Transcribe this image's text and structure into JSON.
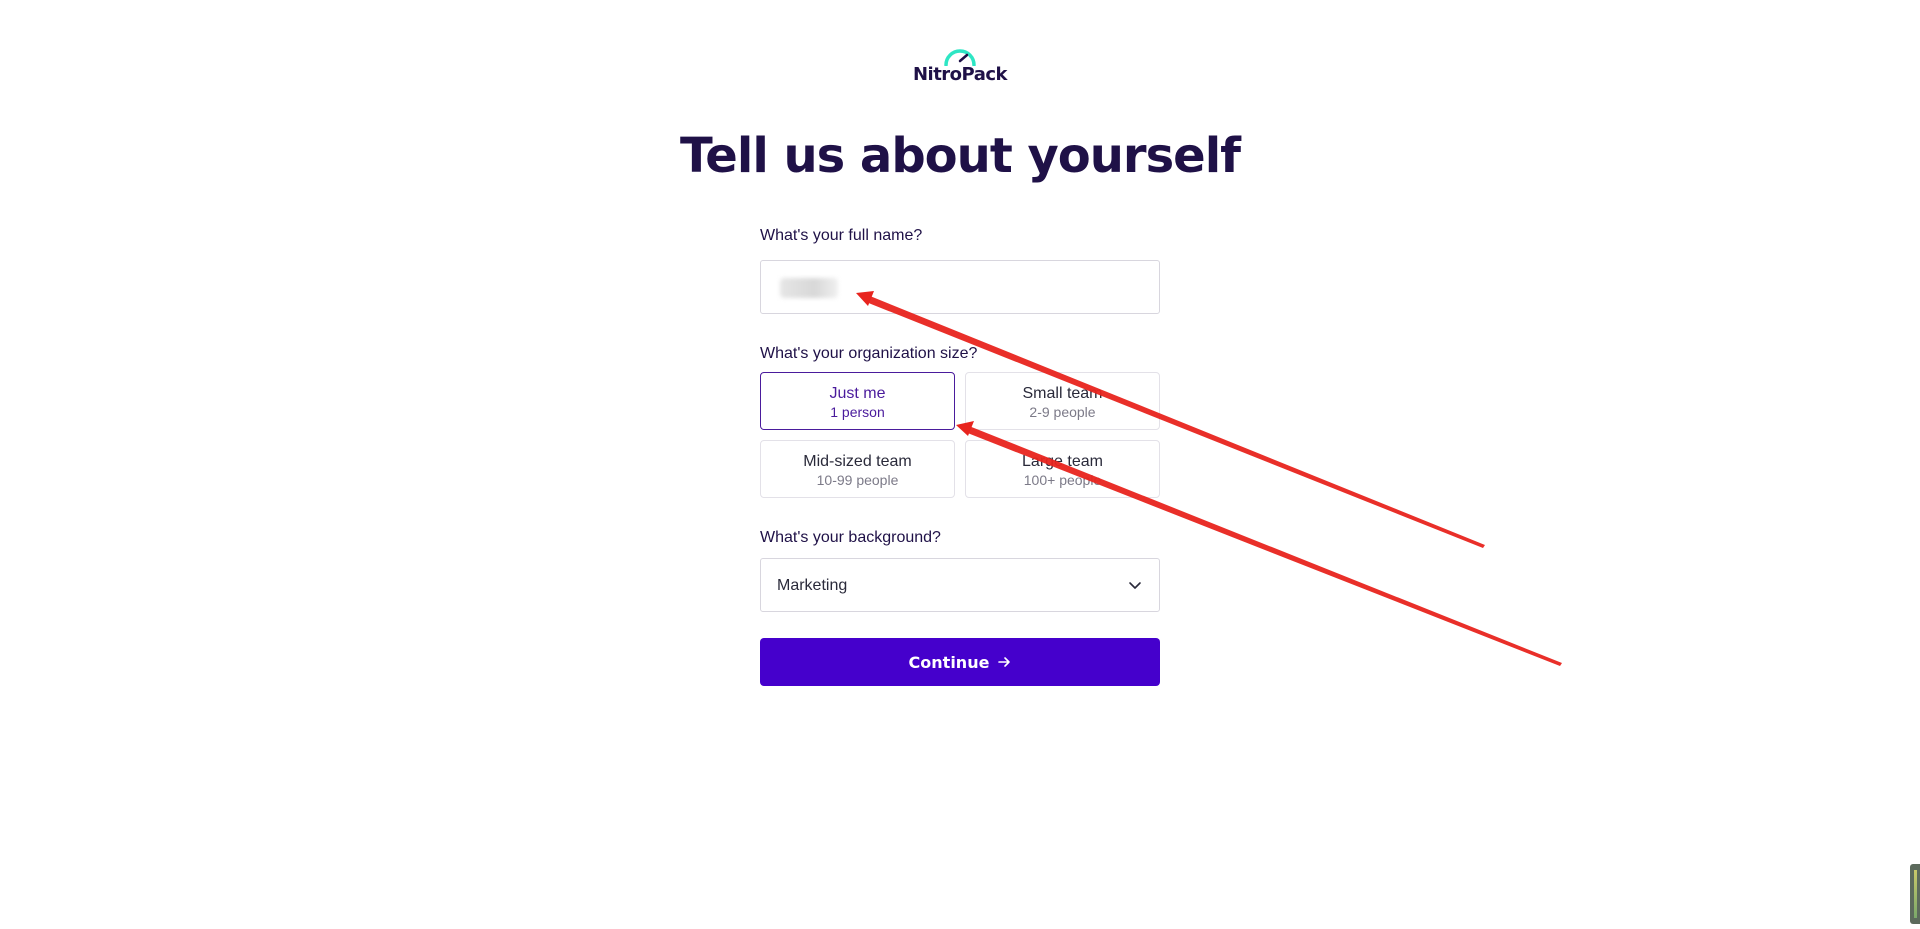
{
  "brand": {
    "name": "NitroPack",
    "logo_icon": "speedometer-icon",
    "accent_color": "#2ee6c4"
  },
  "page": {
    "title": "Tell us about yourself"
  },
  "form": {
    "name_label": "What's your full name?",
    "name_value": "",
    "org_label": "What's your organization size?",
    "org_options": [
      {
        "title": "Just me",
        "subtitle": "1 person",
        "selected": true
      },
      {
        "title": "Small team",
        "subtitle": "2-9 people",
        "selected": false
      },
      {
        "title": "Mid-sized team",
        "subtitle": "10-99 people",
        "selected": false
      },
      {
        "title": "Large team",
        "subtitle": "100+ people",
        "selected": false
      }
    ],
    "background_label": "What's your background?",
    "background_value": "Marketing",
    "continue_label": "Continue",
    "continue_icon": "arrow-right-icon"
  },
  "colors": {
    "primary_button": "#4500cc",
    "heading": "#1f1147",
    "selected_border": "#4a1b9c",
    "annotation_arrow": "#e8241e"
  }
}
